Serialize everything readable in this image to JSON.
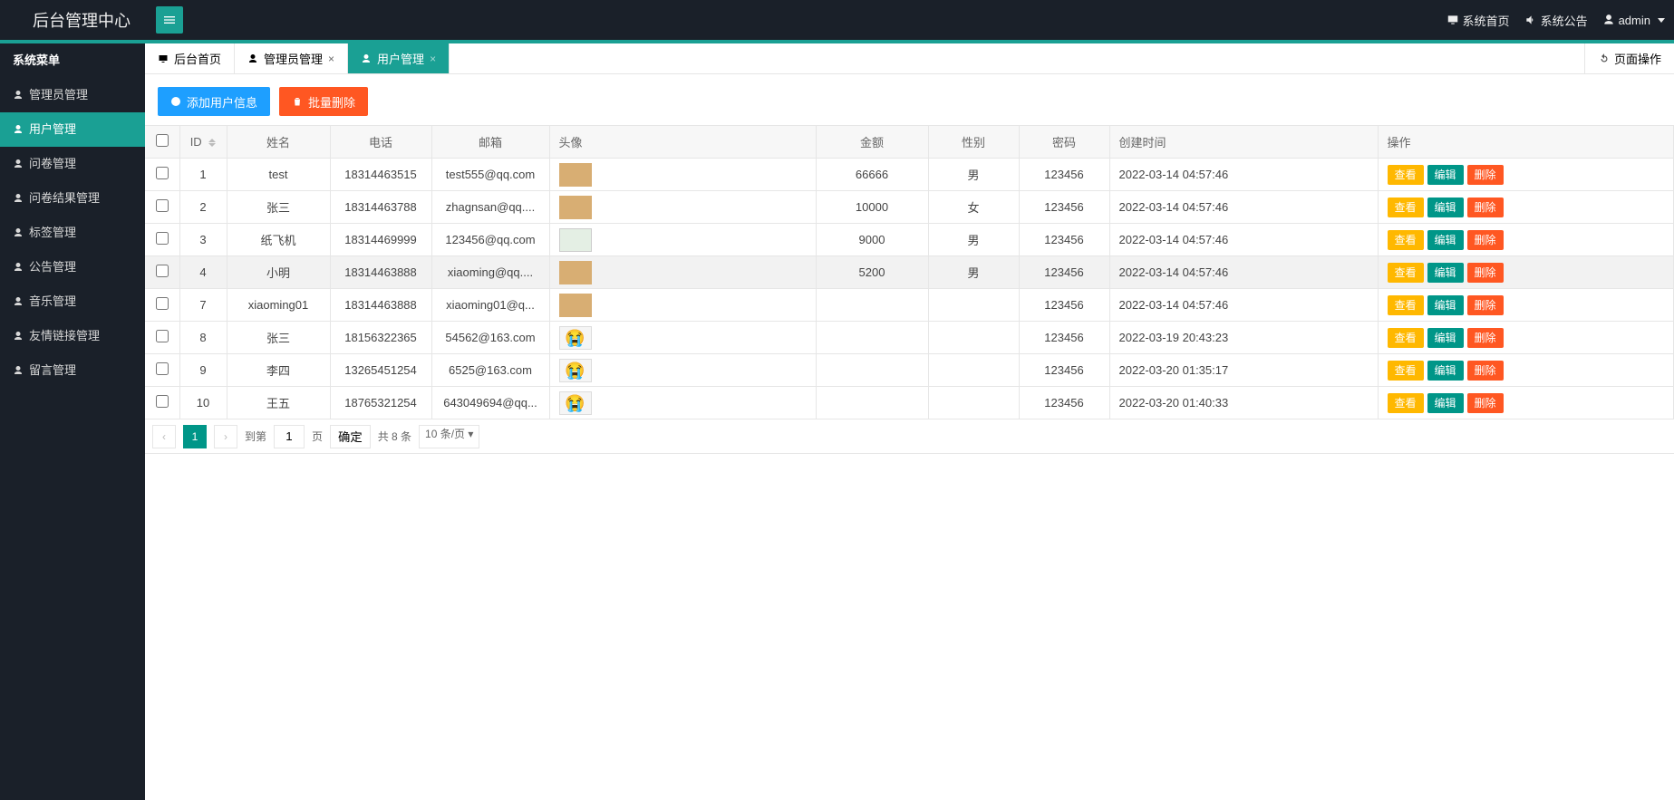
{
  "header": {
    "brand": "后台管理中心",
    "right": {
      "system_home": "系统首页",
      "system_notice": "系统公告",
      "user": "admin"
    }
  },
  "sidebar": {
    "title": "系统菜单",
    "items": [
      {
        "label": "管理员管理"
      },
      {
        "label": "用户管理",
        "active": true
      },
      {
        "label": "问卷管理"
      },
      {
        "label": "问卷结果管理"
      },
      {
        "label": "标签管理"
      },
      {
        "label": "公告管理"
      },
      {
        "label": "音乐管理"
      },
      {
        "label": "友情链接管理"
      },
      {
        "label": "留言管理"
      }
    ]
  },
  "tabs": {
    "items": [
      {
        "label": "后台首页",
        "closable": false
      },
      {
        "label": "管理员管理",
        "closable": true
      },
      {
        "label": "用户管理",
        "closable": true,
        "active": true
      }
    ],
    "page_ops": "页面操作"
  },
  "toolbar": {
    "add_label": "添加用户信息",
    "batch_delete_label": "批量删除"
  },
  "table": {
    "columns": {
      "id": "ID",
      "name": "姓名",
      "phone": "电话",
      "email": "邮箱",
      "avatar": "头像",
      "amount": "金额",
      "gender": "性别",
      "pwd": "密码",
      "created": "创建时间",
      "ops": "操作"
    },
    "ops": {
      "view": "查看",
      "edit": "编辑",
      "delete": "删除"
    },
    "rows": [
      {
        "id": "1",
        "name": "test",
        "phone": "18314463515",
        "email": "test555@qq.com",
        "amount": "66666",
        "gender": "男",
        "pwd": "123456",
        "created": "2022-03-14 04:57:46",
        "avatar": "face"
      },
      {
        "id": "2",
        "name": "张三",
        "phone": "18314463788",
        "email": "zhagnsan@qq....",
        "amount": "10000",
        "gender": "女",
        "pwd": "123456",
        "created": "2022-03-14 04:57:46",
        "avatar": "face"
      },
      {
        "id": "3",
        "name": "纸飞机",
        "phone": "18314469999",
        "email": "123456@qq.com",
        "amount": "9000",
        "gender": "男",
        "pwd": "123456",
        "created": "2022-03-14 04:57:46",
        "avatar": "map"
      },
      {
        "id": "4",
        "name": "小明",
        "phone": "18314463888",
        "email": "xiaoming@qq....",
        "amount": "5200",
        "gender": "男",
        "pwd": "123456",
        "created": "2022-03-14 04:57:46",
        "avatar": "face",
        "selected": true
      },
      {
        "id": "7",
        "name": "xiaoming01",
        "phone": "18314463888",
        "email": "xiaoming01@q...",
        "amount": "",
        "gender": "",
        "pwd": "123456",
        "created": "2022-03-14 04:57:46",
        "avatar": "face"
      },
      {
        "id": "8",
        "name": "张三",
        "phone": "18156322365",
        "email": "54562@163.com",
        "amount": "",
        "gender": "",
        "pwd": "123456",
        "created": "2022-03-19 20:43:23",
        "avatar": "emoji"
      },
      {
        "id": "9",
        "name": "李四",
        "phone": "13265451254",
        "email": "6525@163.com",
        "amount": "",
        "gender": "",
        "pwd": "123456",
        "created": "2022-03-20 01:35:17",
        "avatar": "emoji"
      },
      {
        "id": "10",
        "name": "王五",
        "phone": "18765321254",
        "email": "643049694@qq...",
        "amount": "",
        "gender": "",
        "pwd": "123456",
        "created": "2022-03-20 01:40:33",
        "avatar": "emoji"
      }
    ]
  },
  "pager": {
    "goto": "到第",
    "page_unit": "页",
    "confirm": "确定",
    "total": "共 8 条",
    "per_page": "10 条/页",
    "cur": "1",
    "input": "1"
  }
}
